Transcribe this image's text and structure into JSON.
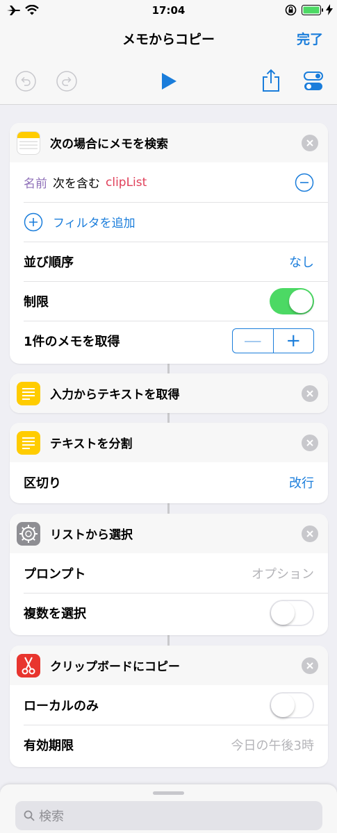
{
  "status_bar": {
    "time": "17:04"
  },
  "nav": {
    "title": "メモからコピー",
    "done_label": "完了"
  },
  "actions": {
    "find_notes": {
      "title": "次の場合にメモを検索",
      "filter": {
        "field": "名前",
        "operator": "次を含む",
        "value": "clipList"
      },
      "add_filter_label": "フィルタを追加",
      "sort_label": "並び順序",
      "sort_value": "なし",
      "limit_label": "制限",
      "limit_on": true,
      "get_label": "1件のメモを取得",
      "stepper_minus": "—",
      "stepper_plus": "+"
    },
    "get_text": {
      "title": "入力からテキストを取得"
    },
    "split_text": {
      "title": "テキストを分割",
      "separator_label": "区切り",
      "separator_value": "改行"
    },
    "choose_list": {
      "title": "リストから選択",
      "prompt_label": "プロンプト",
      "prompt_placeholder": "オプション",
      "multiple_label": "複数を選択",
      "multiple_on": false
    },
    "copy_clipboard": {
      "title": "クリップボードにコピー",
      "local_label": "ローカルのみ",
      "local_on": false,
      "expire_label": "有効期限",
      "expire_placeholder": "今日の午後3時"
    }
  },
  "search": {
    "placeholder": "検索"
  },
  "colors": {
    "accent": "#1a7ddb",
    "toggle_on": "#4cd964",
    "filter_value": "#e0405a",
    "filter_field": "#8e6fb8",
    "scissors_icon_bg": "#e8352e",
    "notes_icon_bg": "#ffcc00",
    "gear_icon_bg": "#8e8e93"
  }
}
